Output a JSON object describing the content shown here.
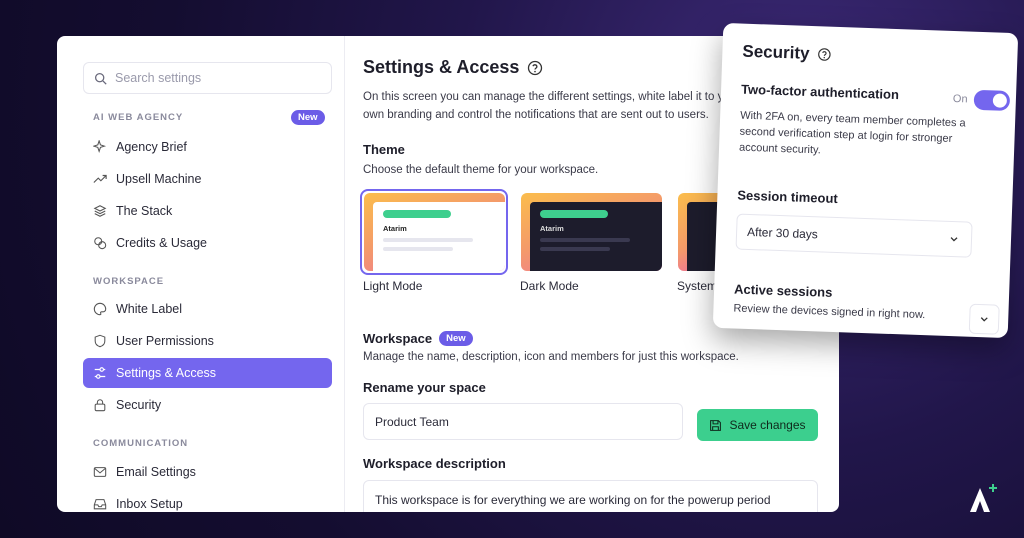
{
  "sidebar": {
    "search_placeholder": "Search settings",
    "sections": {
      "agency": "AI WEB AGENCY",
      "agency_badge": "New",
      "workspace": "WORKSPACE",
      "communication": "COMMUNICATION"
    },
    "items": [
      {
        "label": "Agency Brief",
        "icon": "sparkle-icon"
      },
      {
        "label": "Upsell Machine",
        "icon": "trend-up-icon"
      },
      {
        "label": "The Stack",
        "icon": "layers-icon"
      },
      {
        "label": "Credits & Usage",
        "icon": "coins-icon"
      },
      {
        "label": "White Label",
        "icon": "palette-icon"
      },
      {
        "label": "User Permissions",
        "icon": "shield-icon"
      },
      {
        "label": "Settings & Access",
        "icon": "sliders-icon",
        "active": true
      },
      {
        "label": "Security",
        "icon": "lock-icon"
      },
      {
        "label": "Email Settings",
        "icon": "mail-icon"
      },
      {
        "label": "Inbox Setup",
        "icon": "inbox-icon"
      }
    ]
  },
  "main": {
    "title": "Settings & Access",
    "description": "On this screen you can manage the different settings, white label it to your own branding and control the notifications that are sent out to users.",
    "theme": {
      "heading": "Theme",
      "subtitle": "Choose the default theme for your workspace.",
      "options": [
        {
          "label": "Light Mode",
          "preview_name": "Atarim"
        },
        {
          "label": "Dark Mode",
          "preview_name": "Atarim"
        },
        {
          "label": "System",
          "preview_name": ""
        }
      ]
    },
    "workspace": {
      "heading": "Workspace",
      "badge": "New",
      "subtitle": "Manage the name, description, icon and members for just this workspace.",
      "rename_label": "Rename your space",
      "name_value": "Product Team",
      "save_label": "Save changes",
      "description_label": "Workspace description",
      "description_value": "This workspace is for everything we are working on for the powerup period"
    }
  },
  "security_panel": {
    "title": "Security",
    "twofa_heading": "Two-factor authentication",
    "twofa_state": "On",
    "twofa_enabled": true,
    "twofa_text": "With 2FA on, every team member completes a second verification step at login for stronger account security.",
    "session_heading": "Session timeout",
    "session_value": "After 30 days",
    "active_heading": "Active sessions",
    "active_text": "Review the devices signed in right now."
  },
  "colors": {
    "accent": "#7466ee",
    "success": "#3ccf8e"
  }
}
